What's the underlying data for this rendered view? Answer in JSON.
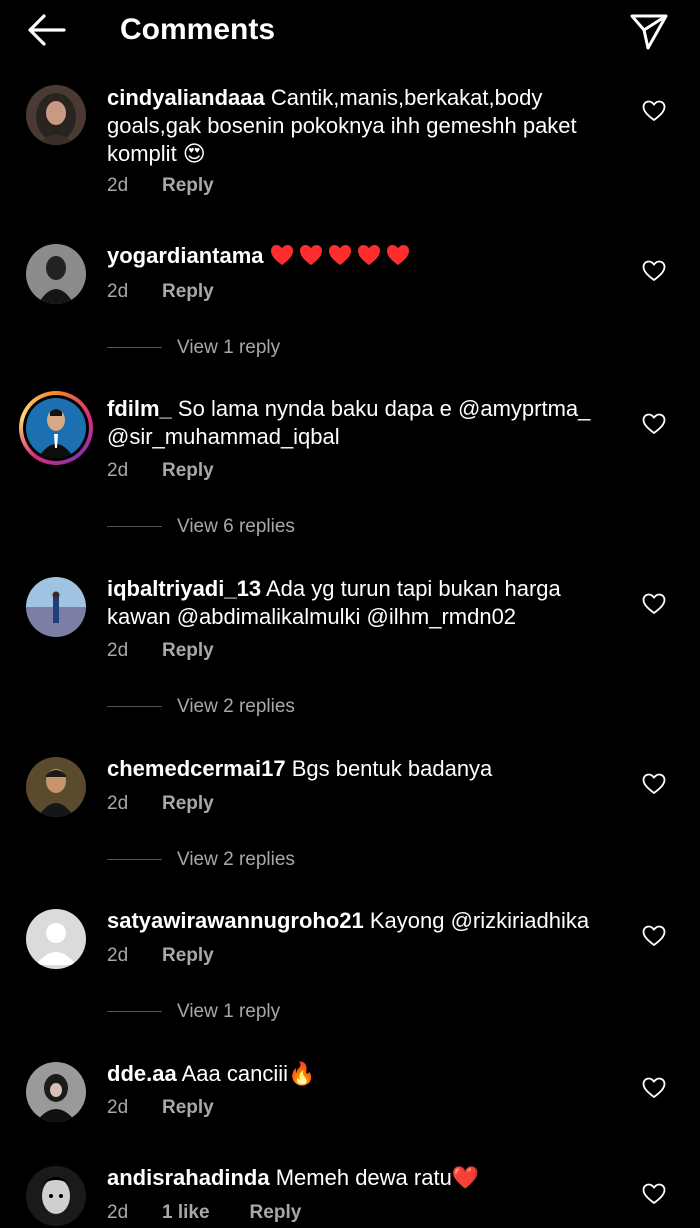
{
  "header": {
    "title": "Comments"
  },
  "comments": [
    {
      "username": "cindyaliandaaa",
      "text": "Cantik,manis,berkakat,body goals,gak bosenin pokoknya ihh gemeshh paket komplit 😍",
      "time": "2d",
      "reply": "Reply"
    },
    {
      "username": "yogardiantama",
      "text": "",
      "emoji_hearts": 5,
      "time": "2d",
      "reply": "Reply",
      "view_replies": "View 1 reply"
    },
    {
      "username": "fdilm_",
      "text": "So lama nynda baku dapa e @amyprtma_ @sir_muhammad_iqbal",
      "time": "2d",
      "reply": "Reply",
      "view_replies": "View 6 replies"
    },
    {
      "username": "iqbaltriyadi_13",
      "text": "Ada yg turun tapi bukan harga kawan @abdimalikalmulki @ilhm_rmdn02",
      "time": "2d",
      "reply": "Reply",
      "view_replies": "View 2 replies"
    },
    {
      "username": "chemedcermai17",
      "text": "Bgs bentuk badanya",
      "time": "2d",
      "reply": "Reply",
      "view_replies": "View 2 replies"
    },
    {
      "username": "satyawirawannugroho21",
      "text": "Kayong @rizkiriadhika",
      "time": "2d",
      "reply": "Reply",
      "view_replies": "View 1 reply"
    },
    {
      "username": "dde.aa",
      "text": "Aaa canciii🔥",
      "time": "2d",
      "reply": "Reply"
    },
    {
      "username": "andisrahadinda",
      "text": "Memeh dewa ratu❤️",
      "time": "2d",
      "likes": "1 like",
      "reply": "Reply"
    }
  ],
  "icons": {
    "back": "arrow-left-icon",
    "send": "paper-plane-icon",
    "like": "heart-outline-icon"
  },
  "colors": {
    "background": "#000000",
    "text": "#ffffff",
    "muted": "#a8a8a8",
    "heart_emoji": "#ff2d2d"
  }
}
